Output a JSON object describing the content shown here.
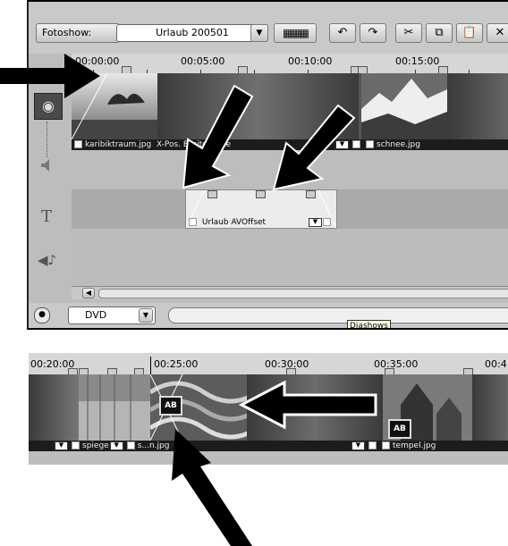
{
  "toolbar": {
    "slideshow_label": "Fotoshow:",
    "slideshow_value": "Urlaub 200501"
  },
  "ruler_top": [
    "00:00:00",
    "00:05:00",
    "00:10:00",
    "00:15:00"
  ],
  "video_track": {
    "clips": [
      {
        "label": "karibiktraum.jpg"
      },
      {
        "label": "X-Pos. Breite Höhe"
      },
      {
        "label": "schnee.jpg"
      }
    ]
  },
  "title_track": {
    "clip_label": "Urlaub AVOffset"
  },
  "bottom_bar": {
    "format_value": "DVD",
    "tooltip": "Diashows"
  },
  "lower_timeline": {
    "ruler": [
      "00:20:00",
      "00:25:00",
      "00:30:00",
      "00:35:00",
      "00:4"
    ],
    "clips": [
      {
        "label": "spiege"
      },
      {
        "label": "s...n.jpg"
      },
      {
        "label": "tempel.jpg"
      }
    ],
    "transition_label": "AB"
  },
  "colors": {
    "panel": "#bdbdbd",
    "video_track": "#555555",
    "arrow": "#000000"
  }
}
